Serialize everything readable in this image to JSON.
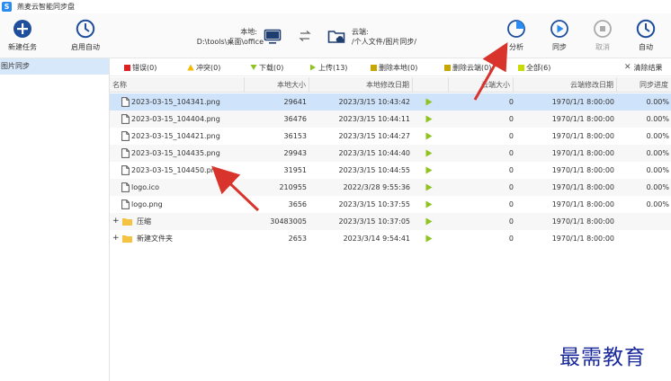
{
  "app": {
    "title": "燕麦云智能同步盘",
    "logo_letter": "S"
  },
  "toolbar": {
    "new_task": "新建任务",
    "auto_start": "启用自动",
    "local_label": "本地:",
    "local_path": "D:\\tools\\桌面\\office",
    "cloud_label": "云端:",
    "cloud_path": "/个人文件/图片同步/",
    "analyze": "分析",
    "sync": "同步",
    "cancel": "取消",
    "auto": "自动"
  },
  "sidebar": {
    "items": [
      {
        "label": "图片同步"
      }
    ]
  },
  "filters": {
    "error": "错误(0)",
    "conflict": "冲突(0)",
    "download": "下载(0)",
    "upload": "上传(13)",
    "delete_local": "删除本地(0)",
    "delete_cloud": "删除云端(0)",
    "all": "全部(6)",
    "clear": "清除结果",
    "colors": {
      "error": "#e02020",
      "conflict": "#f5b800",
      "download": "#8fc31f",
      "upload": "#8fc31f",
      "delete_local": "#c8a600",
      "delete_cloud": "#c8a600",
      "all": "#c8dc00"
    }
  },
  "table": {
    "headers": {
      "name": "名称",
      "local_size": "本地大小",
      "local_mtime": "本地修改日期",
      "cloud_size": "云端大小",
      "cloud_mtime": "云端修改日期",
      "progress": "同步进度"
    },
    "rows": [
      {
        "type": "file",
        "name": "2023-03-15_104341.png",
        "local_size": "29641",
        "local_mtime": "2023/3/15 10:43:42",
        "cloud_size": "0",
        "cloud_mtime": "1970/1/1 8:00:00",
        "progress": "0.00%"
      },
      {
        "type": "file",
        "name": "2023-03-15_104404.png",
        "local_size": "36476",
        "local_mtime": "2023/3/15 10:44:11",
        "cloud_size": "0",
        "cloud_mtime": "1970/1/1 8:00:00",
        "progress": "0.00%"
      },
      {
        "type": "file",
        "name": "2023-03-15_104421.png",
        "local_size": "36153",
        "local_mtime": "2023/3/15 10:44:27",
        "cloud_size": "0",
        "cloud_mtime": "1970/1/1 8:00:00",
        "progress": "0.00%"
      },
      {
        "type": "file",
        "name": "2023-03-15_104435.png",
        "local_size": "29943",
        "local_mtime": "2023/3/15 10:44:40",
        "cloud_size": "0",
        "cloud_mtime": "1970/1/1 8:00:00",
        "progress": "0.00%"
      },
      {
        "type": "file",
        "name": "2023-03-15_104450.png",
        "local_size": "31951",
        "local_mtime": "2023/3/15 10:44:55",
        "cloud_size": "0",
        "cloud_mtime": "1970/1/1 8:00:00",
        "progress": "0.00%"
      },
      {
        "type": "file",
        "name": "logo.ico",
        "local_size": "210955",
        "local_mtime": "2022/3/28 9:55:36",
        "cloud_size": "0",
        "cloud_mtime": "1970/1/1 8:00:00",
        "progress": "0.00%"
      },
      {
        "type": "file",
        "name": "logo.png",
        "local_size": "3656",
        "local_mtime": "2023/3/15 10:37:55",
        "cloud_size": "0",
        "cloud_mtime": "1970/1/1 8:00:00",
        "progress": "0.00%"
      },
      {
        "type": "folder",
        "expand": "+",
        "name": "压缩",
        "local_size": "30483005",
        "local_mtime": "2023/3/15 10:37:05",
        "cloud_size": "0",
        "cloud_mtime": "1970/1/1 8:00:00",
        "progress": ""
      },
      {
        "type": "folder",
        "expand": "+",
        "name": "新建文件夹",
        "local_size": "2653",
        "local_mtime": "2023/3/14 9:54:41",
        "cloud_size": "0",
        "cloud_mtime": "1970/1/1 8:00:00",
        "progress": ""
      }
    ]
  },
  "watermark": "最需教育",
  "colors": {
    "accent": "#2a8cf0",
    "selected_row": "#cfe3fa",
    "play_arrow": "#8fc31f",
    "folder": "#f5c342",
    "annotation_arrow": "#d9342b"
  }
}
